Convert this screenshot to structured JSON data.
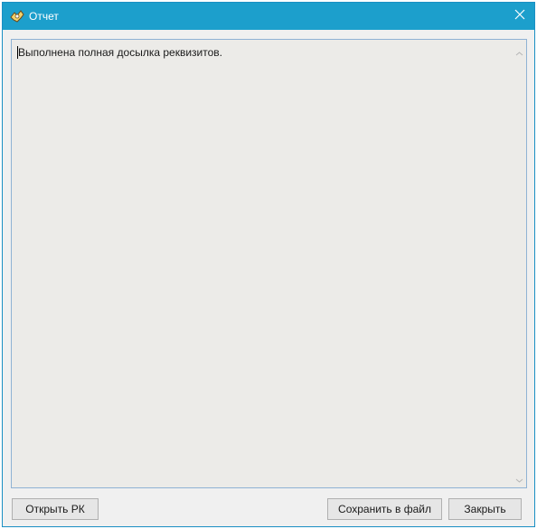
{
  "window": {
    "title": "Отчет",
    "icon": "app-icon",
    "close_icon": "close-icon"
  },
  "report": {
    "text": "Выполнена полная досылка реквизитов."
  },
  "buttons": {
    "open_rk": "Открыть РК",
    "save_to_file": "Сохранить в файл",
    "close": "Закрыть"
  },
  "colors": {
    "titlebar": "#1c9fcc",
    "textarea_bg": "#ecebe8",
    "window_bg": "#f0f0f0"
  }
}
